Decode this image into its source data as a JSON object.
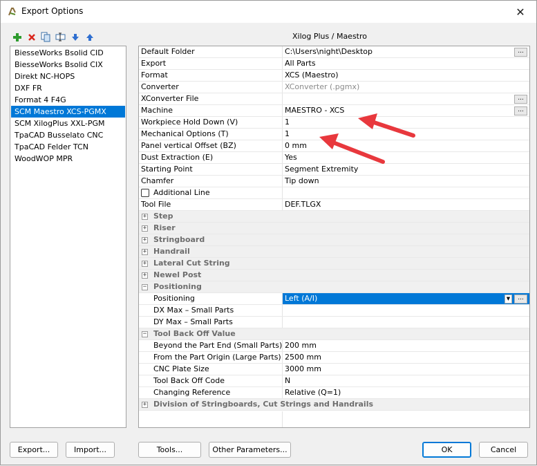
{
  "window": {
    "title": "Export Options"
  },
  "toolbar": {
    "icons": [
      "add-icon",
      "delete-icon",
      "copy-icon",
      "rename-icon",
      "move-down-icon",
      "move-up-icon"
    ]
  },
  "section_title": "Xilog Plus / Maestro",
  "formats": [
    "BiesseWorks Bsolid CID",
    "BiesseWorks Bsolid CIX",
    "Direkt NC-HOPS",
    "DXF FR",
    "Format 4 F4G",
    "SCM Maestro XCS-PGMX",
    "SCM XilogPlus XXL-PGM",
    "TpaCAD Busselato CNC",
    "TpaCAD Felder TCN",
    "WoodWOP MPR"
  ],
  "selected_format_index": 5,
  "properties": {
    "default_folder": {
      "label": "Default Folder",
      "value": "C:\\Users\\night\\Desktop"
    },
    "export": {
      "label": "Export",
      "value": "All Parts"
    },
    "format": {
      "label": "Format",
      "value": "XCS (Maestro)"
    },
    "converter": {
      "label": "Converter",
      "value": "XConverter (.pgmx)"
    },
    "xconverter_file": {
      "label": "XConverter File",
      "value": ""
    },
    "machine": {
      "label": "Machine",
      "value": "MAESTRO - XCS"
    },
    "workpiece_hold_down": {
      "label": "Workpiece Hold Down (V)",
      "value": "1"
    },
    "mechanical_options": {
      "label": "Mechanical Options (T)",
      "value": "1"
    },
    "panel_vertical_offset": {
      "label": "Panel vertical Offset (BZ)",
      "value": "0 mm"
    },
    "dust_extraction": {
      "label": "Dust Extraction (E)",
      "value": "Yes"
    },
    "starting_point": {
      "label": "Starting Point",
      "value": "Segment Extremity"
    },
    "chamfer": {
      "label": "Chamfer",
      "value": "Tip down"
    },
    "additional_line": {
      "label": "Additional Line",
      "value": ""
    },
    "tool_file": {
      "label": "Tool File",
      "value": "DEF.TLGX"
    }
  },
  "groups": {
    "step": "Step",
    "riser": "Riser",
    "stringboard": "Stringboard",
    "handrail": "Handrail",
    "lateral_cut_string": "Lateral Cut String",
    "newel_post": "Newel Post",
    "positioning": "Positioning",
    "tool_back_off_value": "Tool Back Off Value",
    "division": "Division of Stringboards, Cut Strings and Handrails"
  },
  "positioning": {
    "positioning": {
      "label": "Positioning",
      "value": "Left (A/I)"
    },
    "dx_max": {
      "label": "DX Max – Small Parts",
      "value": ""
    },
    "dy_max": {
      "label": "DY Max – Small Parts",
      "value": ""
    }
  },
  "tool_back_off": {
    "beyond": {
      "label": "Beyond the Part End (Small Parts)",
      "value": "200 mm"
    },
    "from_origin": {
      "label": "From the Part Origin (Large Parts)",
      "value": "2500 mm"
    },
    "cnc_plate": {
      "label": "CNC Plate Size",
      "value": "3000 mm"
    },
    "code": {
      "label": "Tool Back Off Code",
      "value": "N"
    },
    "changing_ref": {
      "label": "Changing Reference",
      "value": "Relative (Q=1)"
    }
  },
  "buttons": {
    "export": "Export...",
    "import": "Import...",
    "tools": "Tools...",
    "other_parameters": "Other Parameters...",
    "ok": "OK",
    "cancel": "Cancel"
  },
  "ellipsis": "...",
  "colors": {
    "selection": "#0078d7",
    "annotation_arrow": "#e8383d"
  }
}
